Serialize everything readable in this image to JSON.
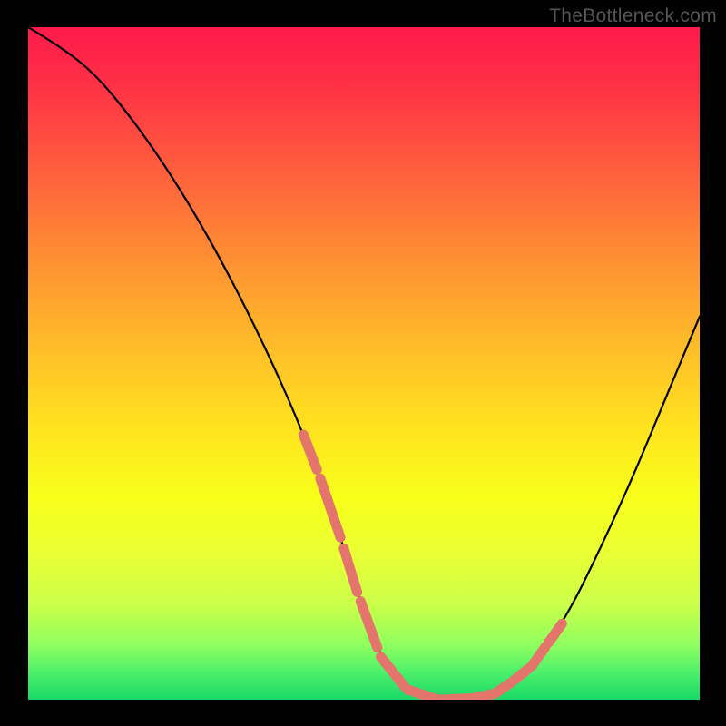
{
  "attribution": "TheBottleneck.com",
  "colors": {
    "page_bg": "#000000",
    "gradient_top": "#ff1a4b",
    "gradient_bottom": "#19d867",
    "curve": "#000000",
    "dash": "#e3756c",
    "attribution_text": "#555557"
  },
  "chart_data": {
    "type": "line",
    "title": "",
    "xlabel": "",
    "ylabel": "",
    "xlim": [
      0,
      100
    ],
    "ylim": [
      0,
      100
    ],
    "grid": false,
    "legend": null,
    "series": [
      {
        "name": "bottleneck-curve",
        "x": [
          0,
          5,
          10,
          15,
          20,
          25,
          30,
          35,
          40,
          45,
          49,
          53,
          57,
          61,
          65,
          70,
          75,
          80,
          85,
          90,
          95,
          100
        ],
        "y": [
          100,
          97,
          93,
          87,
          80,
          72,
          63,
          53,
          42,
          29,
          16,
          5,
          1,
          0,
          0,
          1,
          5,
          12,
          22,
          33,
          45,
          57
        ]
      }
    ],
    "highlight_segments": {
      "description": "salmon dashed segments along the curve (near the valley and its approaches)",
      "x_ranges": [
        [
          41,
          43
        ],
        [
          43.5,
          46.5
        ],
        [
          47,
          49
        ],
        [
          49.5,
          52
        ],
        [
          52.5,
          56
        ],
        [
          56.5,
          61
        ],
        [
          61.5,
          66
        ],
        [
          66.5,
          69
        ],
        [
          69.5,
          72
        ],
        [
          72.5,
          74.5
        ],
        [
          75,
          77
        ],
        [
          77.5,
          79.5
        ]
      ]
    }
  }
}
